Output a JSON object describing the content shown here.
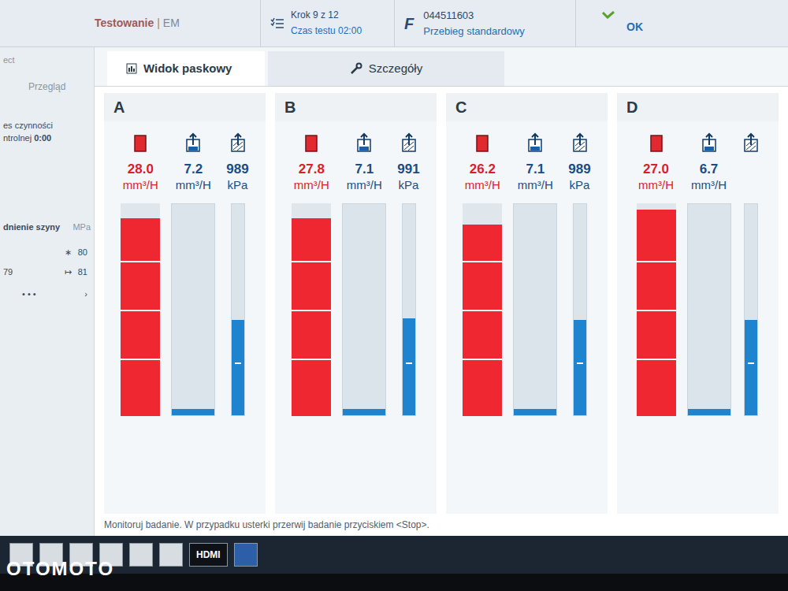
{
  "header": {
    "section": "Testowanie",
    "separator": "|",
    "mode": "EM",
    "step": "Krok 9 z 12",
    "time": "Czas testu 02:00",
    "part_number": "044511603",
    "run": "Przebieg standardowy",
    "status": "OK"
  },
  "sidebar": {
    "cut_title": "ect",
    "overview": "Przegląd",
    "activity_label": "es czynności",
    "control_label": "ntrolnej",
    "control_time": "0:00",
    "rail_label": "dnienie szyny",
    "rail_unit": "MPa",
    "rail_top": {
      "symbol": "∗",
      "value": "80"
    },
    "rail_left": "79",
    "rail_right": {
      "symbol": "↦",
      "value": "81"
    },
    "dots": "• • •",
    "more": "›"
  },
  "tabs": [
    {
      "label": "Widok paskowy",
      "selected": true
    },
    {
      "label": "Szczegóły",
      "selected": false
    }
  ],
  "channels": [
    {
      "label": "A",
      "meters": [
        {
          "kind": "injection",
          "value": "28.0",
          "unit": "mm³/H",
          "level": 0.93
        },
        {
          "kind": "return",
          "value": "7.2",
          "unit": "mm³/H",
          "level": 0.03
        },
        {
          "kind": "pressure",
          "value": "989",
          "unit": "kPa",
          "level": 0.45
        }
      ]
    },
    {
      "label": "B",
      "meters": [
        {
          "kind": "injection",
          "value": "27.8",
          "unit": "mm³/H",
          "level": 0.93
        },
        {
          "kind": "return",
          "value": "7.1",
          "unit": "mm³/H",
          "level": 0.03
        },
        {
          "kind": "pressure",
          "value": "991",
          "unit": "kPa",
          "level": 0.46
        }
      ]
    },
    {
      "label": "C",
      "meters": [
        {
          "kind": "injection",
          "value": "26.2",
          "unit": "mm³/H",
          "level": 0.9
        },
        {
          "kind": "return",
          "value": "7.1",
          "unit": "mm³/H",
          "level": 0.03
        },
        {
          "kind": "pressure",
          "value": "989",
          "unit": "kPa",
          "level": 0.45
        }
      ]
    },
    {
      "label": "D",
      "meters": [
        {
          "kind": "injection",
          "value": "27.0",
          "unit": "mm³/H",
          "level": 0.97
        },
        {
          "kind": "return",
          "value": "6.7",
          "unit": "mm³/H",
          "level": 0.03
        },
        {
          "kind": "pressure",
          "level": 0.45
        }
      ]
    }
  ],
  "instruction": "Monitoruj badanie. W przypadku usterki przerwij badanie przyciskiem <Stop>.",
  "taskbar": {
    "hdmi": "HDMI"
  },
  "watermark": "OTOMOTO"
}
